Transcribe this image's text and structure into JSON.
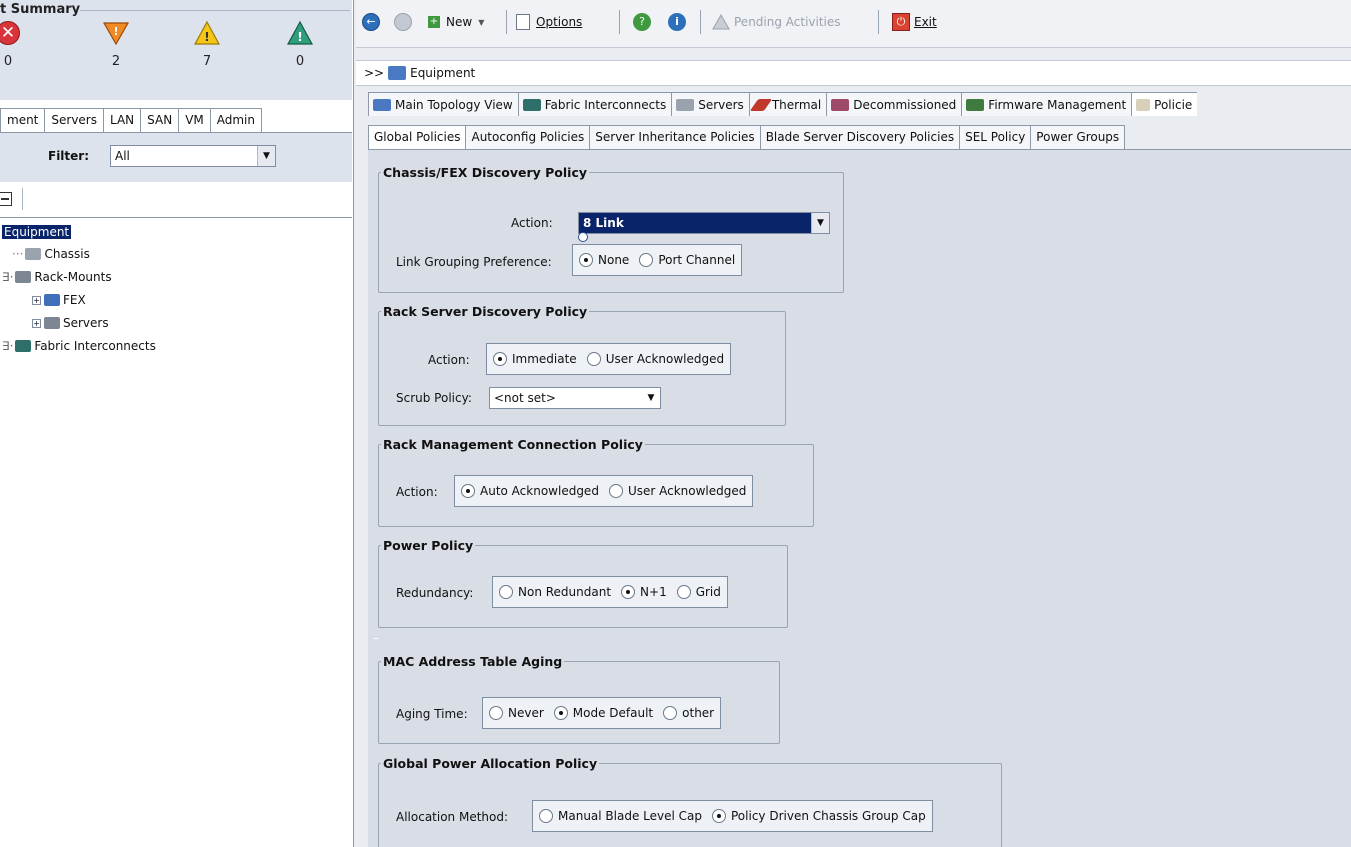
{
  "left": {
    "fault_summary": {
      "title": "t Summary",
      "counts": [
        {
          "icon": "critical-icon",
          "value": "0"
        },
        {
          "icon": "major-icon",
          "value": "2"
        },
        {
          "icon": "minor-icon",
          "value": "7"
        },
        {
          "icon": "warning-icon",
          "value": "0"
        }
      ]
    },
    "nav_tabs": [
      "ment",
      "Servers",
      "LAN",
      "SAN",
      "VM",
      "Admin"
    ],
    "filter": {
      "label": "Filter:",
      "value": "All"
    },
    "tree": [
      {
        "label": "Equipment",
        "icon": "equipment-icon"
      },
      {
        "label": "Chassis",
        "icon": "chassis-icon"
      },
      {
        "label": "Rack-Mounts",
        "icon": "rack-mounts-icon"
      },
      {
        "label": "FEX",
        "icon": "fex-icon"
      },
      {
        "label": "Servers",
        "icon": "servers-icon"
      },
      {
        "label": "Fabric Interconnects",
        "icon": "fabric-interconnects-icon"
      }
    ]
  },
  "toolbar": {
    "new_label": "New",
    "options_label": "Options",
    "pending_label": "Pending Activities",
    "exit_label": "Exit"
  },
  "path": {
    "prefix": ">>",
    "label": "Equipment"
  },
  "main_tabs": [
    {
      "label": "Main Topology View",
      "icon": "topology-icon"
    },
    {
      "label": "Fabric Interconnects",
      "icon": "fabric-icon"
    },
    {
      "label": "Servers",
      "icon": "servers-icon"
    },
    {
      "label": "Thermal",
      "icon": "thermal-icon"
    },
    {
      "label": "Decommissioned",
      "icon": "decommissioned-icon"
    },
    {
      "label": "Firmware Management",
      "icon": "firmware-icon"
    },
    {
      "label": "Policie",
      "icon": "policies-icon"
    }
  ],
  "sub_tabs": [
    "Global Policies",
    "Autoconfig Policies",
    "Server Inheritance Policies",
    "Blade Server Discovery Policies",
    "SEL Policy",
    "Power Groups"
  ],
  "policies": {
    "chassis": {
      "title": "Chassis/FEX Discovery Policy",
      "action_label": "Action:",
      "action_value": "8 Link",
      "link_label": "Link Grouping Preference:",
      "link_options": [
        "None",
        "Port Channel"
      ],
      "link_selected": "None"
    },
    "rack_discovery": {
      "title": "Rack Server Discovery Policy",
      "action_label": "Action:",
      "action_options": [
        "Immediate",
        "User Acknowledged"
      ],
      "action_selected": "Immediate",
      "scrub_label": "Scrub Policy:",
      "scrub_value": "<not set>"
    },
    "rack_mgmt": {
      "title": "Rack Management Connection Policy",
      "action_label": "Action:",
      "options": [
        "Auto Acknowledged",
        "User Acknowledged"
      ],
      "selected": "Auto Acknowledged"
    },
    "power": {
      "title": "Power Policy",
      "label": "Redundancy:",
      "options": [
        "Non Redundant",
        "N+1",
        "Grid"
      ],
      "selected": "N+1"
    },
    "mac": {
      "title": "MAC Address Table Aging",
      "label": "Aging Time:",
      "options": [
        "Never",
        "Mode Default",
        "other"
      ],
      "selected": "Mode Default"
    },
    "global_power": {
      "title": "Global Power Allocation Policy",
      "label": "Allocation Method:",
      "options": [
        "Manual Blade Level Cap",
        "Policy Driven Chassis Group Cap"
      ],
      "selected": "Policy Driven Chassis Group Cap"
    }
  }
}
